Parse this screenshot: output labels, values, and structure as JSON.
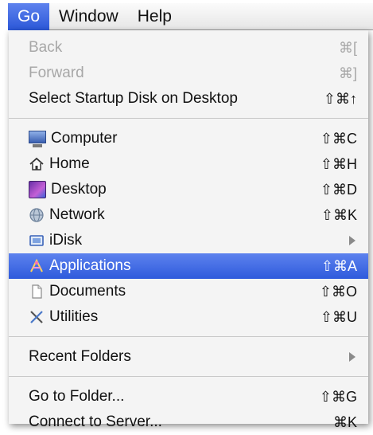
{
  "menubar": {
    "items": [
      "Go",
      "Window",
      "Help"
    ]
  },
  "menu": {
    "nav": [
      {
        "label": "Back",
        "shortcut": "⌘[",
        "disabled": true
      },
      {
        "label": "Forward",
        "shortcut": "⌘]",
        "disabled": true
      },
      {
        "label": "Select Startup Disk on Desktop",
        "shortcut": "⇧⌘↑",
        "disabled": false
      }
    ],
    "places": [
      {
        "label": "Computer",
        "shortcut": "⇧⌘C",
        "icon": "computer-icon"
      },
      {
        "label": "Home",
        "shortcut": "⇧⌘H",
        "icon": "home-icon"
      },
      {
        "label": "Desktop",
        "shortcut": "⇧⌘D",
        "icon": "desktop-icon"
      },
      {
        "label": "Network",
        "shortcut": "⇧⌘K",
        "icon": "network-icon"
      },
      {
        "label": "iDisk",
        "shortcut": "",
        "icon": "idisk-icon",
        "submenu": true
      },
      {
        "label": "Applications",
        "shortcut": "⇧⌘A",
        "icon": "applications-icon",
        "highlighted": true
      },
      {
        "label": "Documents",
        "shortcut": "⇧⌘O",
        "icon": "documents-icon"
      },
      {
        "label": "Utilities",
        "shortcut": "⇧⌘U",
        "icon": "utilities-icon"
      }
    ],
    "recent_folders": {
      "label": "Recent Folders",
      "submenu": true
    },
    "folder_actions": [
      {
        "label": "Go to Folder...",
        "shortcut": "⇧⌘G"
      },
      {
        "label": "Connect to Server...",
        "shortcut": "⌘K"
      }
    ]
  },
  "colors": {
    "highlight": "#3a63e0",
    "disabled_text": "#a7a7a7",
    "menu_background": "#f4f4f4"
  }
}
